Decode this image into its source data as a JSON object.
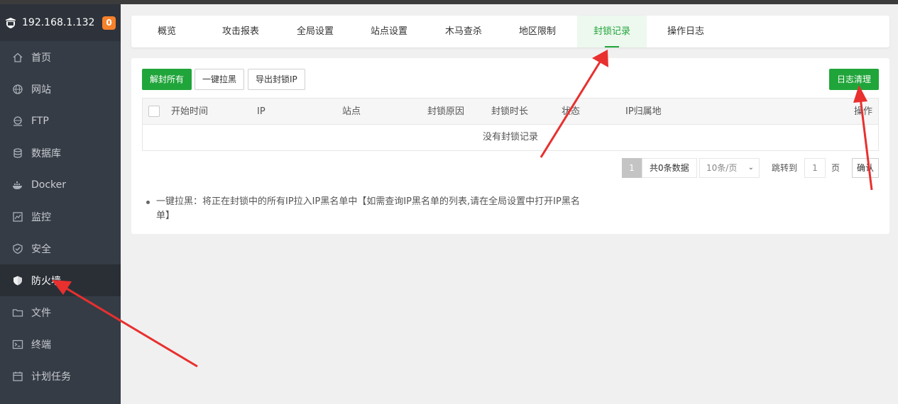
{
  "sidebar": {
    "host": "192.168.1.132",
    "badge": "0",
    "items": [
      {
        "label": "首页",
        "icon": "home-icon"
      },
      {
        "label": "网站",
        "icon": "globe-icon"
      },
      {
        "label": "FTP",
        "icon": "ftp-icon"
      },
      {
        "label": "数据库",
        "icon": "database-icon"
      },
      {
        "label": "Docker",
        "icon": "docker-icon"
      },
      {
        "label": "监控",
        "icon": "monitor-icon"
      },
      {
        "label": "安全",
        "icon": "shield-check-icon"
      },
      {
        "label": "防火墙",
        "icon": "firewall-icon",
        "active": true
      },
      {
        "label": "文件",
        "icon": "folder-icon"
      },
      {
        "label": "终端",
        "icon": "terminal-icon"
      },
      {
        "label": "计划任务",
        "icon": "calendar-icon"
      }
    ]
  },
  "tabs": [
    "概览",
    "攻击报表",
    "全局设置",
    "站点设置",
    "木马查杀",
    "地区限制",
    "封锁记录",
    "操作日志"
  ],
  "active_tab": "封锁记录",
  "toolbar": {
    "unblock_all": "解封所有",
    "blacklist_all": "一键拉黑",
    "export": "导出封锁IP",
    "clear_log": "日志清理"
  },
  "table": {
    "columns": [
      "开始时间",
      "IP",
      "站点",
      "封锁原因",
      "封锁时长",
      "状态",
      "IP归属地",
      "操作"
    ],
    "empty": "没有封锁记录"
  },
  "pager": {
    "current": "1",
    "total": "共0条数据",
    "per_page": "10条/页",
    "jump_label": "跳转到",
    "jump_value": "1",
    "page_label": "页",
    "confirm": "确认"
  },
  "note": "一键拉黑：将正在封锁中的所有IP拉入IP黑名单中【如需查询IP黑名单的列表,请在全局设置中打开IP黑名单】",
  "colors": {
    "accent": "#20a53a",
    "sidebar_bg": "#363c45",
    "badge": "#f7812a",
    "annotation_arrow": "#e8302f"
  }
}
